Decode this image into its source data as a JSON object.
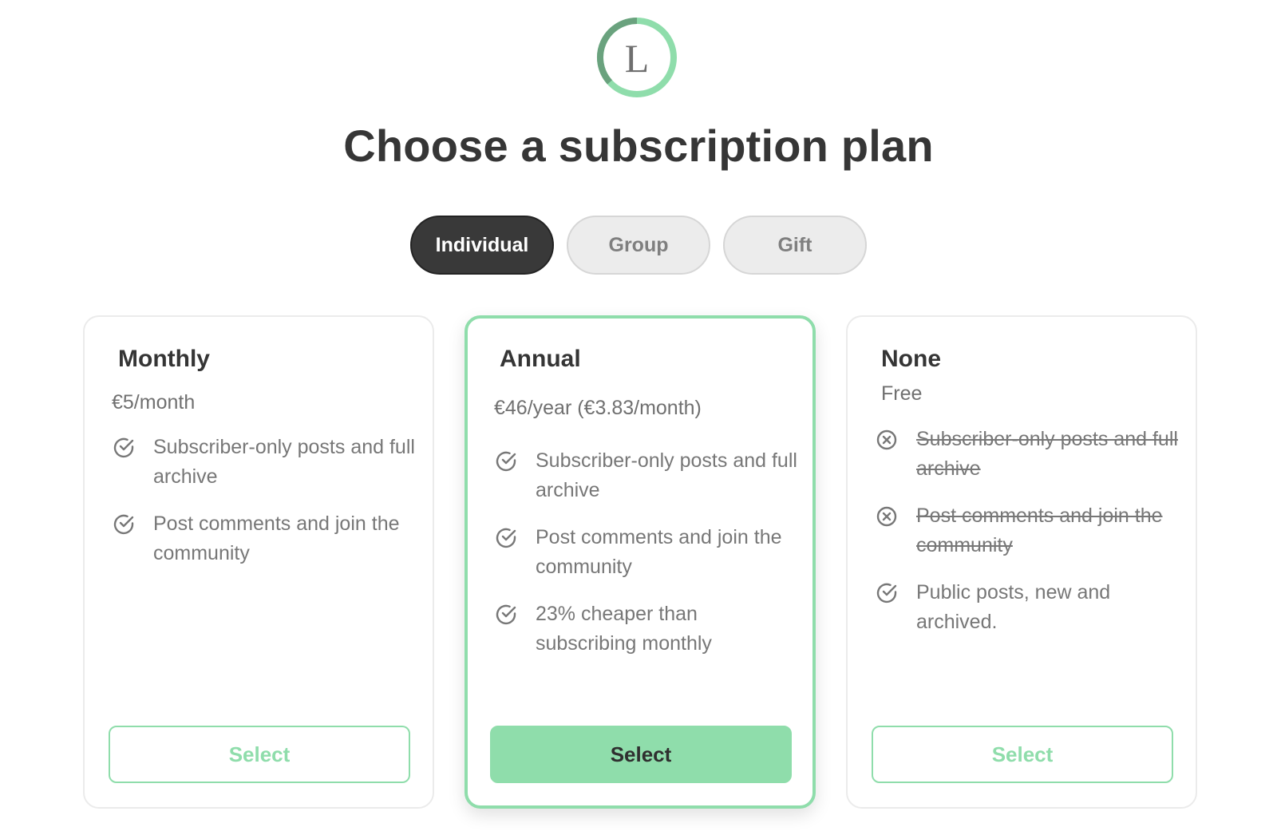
{
  "brand": {
    "logo_letter": "L",
    "accent_color": "#8fddab",
    "dark_color": "#393939"
  },
  "page": {
    "title": "Choose a subscription plan"
  },
  "tabs": [
    {
      "label": "Individual",
      "active": true
    },
    {
      "label": "Group",
      "active": false
    },
    {
      "label": "Gift",
      "active": false
    }
  ],
  "plans": [
    {
      "name": "Monthly",
      "price": "€5/month",
      "featured": false,
      "features": [
        {
          "text": "Subscriber-only posts and full archive",
          "icon": "check-circle-icon",
          "included": true
        },
        {
          "text": "Post comments and join the community",
          "icon": "check-circle-icon",
          "included": true
        }
      ],
      "button_label": "Select"
    },
    {
      "name": "Annual",
      "price": "€46/year (€3.83/month)",
      "featured": true,
      "features": [
        {
          "text": "Subscriber-only posts and full archive",
          "icon": "check-circle-icon",
          "included": true
        },
        {
          "text": "Post comments and join the community",
          "icon": "check-circle-icon",
          "included": true
        },
        {
          "text": "23% cheaper than subscribing monthly",
          "icon": "check-circle-icon",
          "included": true
        }
      ],
      "button_label": "Select"
    },
    {
      "name": "None",
      "price": "Free",
      "featured": false,
      "features": [
        {
          "text": "Subscriber-only posts and full archive",
          "icon": "x-circle-icon",
          "included": false
        },
        {
          "text": "Post comments and join the community",
          "icon": "x-circle-icon",
          "included": false
        },
        {
          "text": "Public posts, new and archived.",
          "icon": "check-circle-icon",
          "included": true
        }
      ],
      "button_label": "Select"
    }
  ]
}
